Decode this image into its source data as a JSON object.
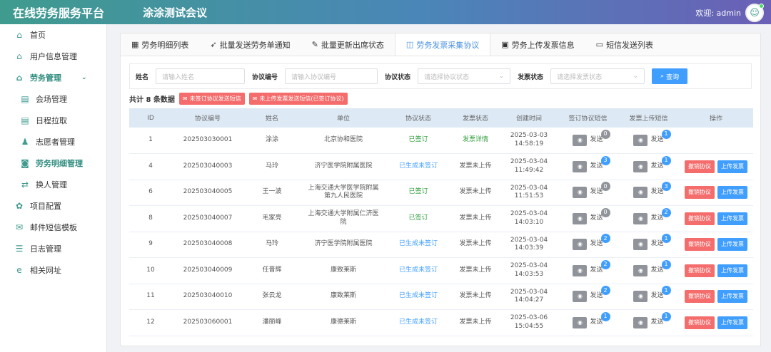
{
  "header": {
    "brand": "在线劳务服务平台",
    "meeting": "涂涂测试会议",
    "welcome": "欢迎: admin"
  },
  "sidebar": [
    {
      "label": "首页",
      "icon": "⌂",
      "cls": ""
    },
    {
      "label": "用户信息管理",
      "icon": "⌂",
      "cls": ""
    },
    {
      "label": "劳务管理",
      "icon": "⌂",
      "cls": "parent",
      "arrow": "⌄"
    },
    {
      "label": "会场管理",
      "icon": "▤",
      "cls": "sub"
    },
    {
      "label": "日程拉取",
      "icon": "▤",
      "cls": "sub"
    },
    {
      "label": "志愿者管理",
      "icon": "♟",
      "cls": "sub"
    },
    {
      "label": "劳务明细管理",
      "icon": "◙",
      "cls": "sub active"
    },
    {
      "label": "换人管理",
      "icon": "⇄",
      "cls": "sub"
    },
    {
      "label": "项目配置",
      "icon": "✿",
      "cls": ""
    },
    {
      "label": "邮件短信模板",
      "icon": "✉",
      "cls": ""
    },
    {
      "label": "日志管理",
      "icon": "☰",
      "cls": ""
    },
    {
      "label": "相关网址",
      "icon": "e",
      "cls": ""
    }
  ],
  "tabs": [
    {
      "label": "劳务明细列表",
      "icon": "▦",
      "active": false
    },
    {
      "label": "批量发送劳务单通知",
      "icon": "➶",
      "active": false
    },
    {
      "label": "批量更新出席状态",
      "icon": "✎",
      "active": false
    },
    {
      "label": "劳务发票采集协议",
      "icon": "◫",
      "active": true
    },
    {
      "label": "劳务上传发票信息",
      "icon": "▣",
      "active": false
    },
    {
      "label": "短信发送列表",
      "icon": "▭",
      "active": false
    }
  ],
  "filters": {
    "name_label": "姓名",
    "name_ph": "请输入姓名",
    "no_label": "协议编号",
    "no_ph": "请输入协议编号",
    "status_label": "协议状态",
    "status_ph": "请选择协议状态",
    "invoice_label": "发票状态",
    "invoice_ph": "请选择发票状态",
    "query": "查询"
  },
  "summary": {
    "count": "共计 8 条数据",
    "btn1": "未签订协议发送短信",
    "btn2": "未上传发票发送短信(已签订协议)"
  },
  "columns": [
    "ID",
    "协议编号",
    "姓名",
    "单位",
    "协议状态",
    "发票状态",
    "创建时间",
    "签订协议短信",
    "发票上传短信",
    "操作"
  ],
  "send_label": "发送",
  "op_labels": {
    "remove": "撤销协议",
    "upload": "上传发票"
  },
  "rows": [
    {
      "id": "1",
      "no": "202503030001",
      "name": "涂涂",
      "unit": "北京协和医院",
      "status": "已签订",
      "status_cls": "ok",
      "invoice": "发票详情",
      "inv_cls": "green",
      "time": "2025-03-03\n14:58:19",
      "s1": "0",
      "s1c": "gray",
      "s2": "1",
      "s2c": "blue",
      "ops": false
    },
    {
      "id": "4",
      "no": "202503040003",
      "name": "马玲",
      "unit": "济宁医学院附属医院",
      "status": "已生成未签订",
      "status_cls": "blue",
      "invoice": "发票未上传",
      "inv_cls": "",
      "time": "2025-03-04\n11:49:42",
      "s1": "3",
      "s1c": "blue",
      "s2": "1",
      "s2c": "blue",
      "ops": true
    },
    {
      "id": "6",
      "no": "202503040005",
      "name": "王一波",
      "unit": "上海交通大学医学院附属\n第九人民医院",
      "status": "已签订",
      "status_cls": "ok",
      "invoice": "发票未上传",
      "inv_cls": "",
      "time": "2025-03-04\n11:51:53",
      "s1": "0",
      "s1c": "gray",
      "s2": "3",
      "s2c": "blue",
      "ops": true
    },
    {
      "id": "8",
      "no": "202503040007",
      "name": "毛家亮",
      "unit": "上海交通大学附属仁济医\n院",
      "status": "已签订",
      "status_cls": "ok",
      "invoice": "发票未上传",
      "inv_cls": "",
      "time": "2025-03-04\n14:03:10",
      "s1": "0",
      "s1c": "gray",
      "s2": "2",
      "s2c": "blue",
      "ops": true
    },
    {
      "id": "9",
      "no": "202503040008",
      "name": "马玲",
      "unit": "济宁医学院附属医院",
      "status": "已生成未签订",
      "status_cls": "blue",
      "invoice": "发票未上传",
      "inv_cls": "",
      "time": "2025-03-04\n14:03:39",
      "s1": "2",
      "s1c": "blue",
      "s2": "1",
      "s2c": "blue",
      "ops": true
    },
    {
      "id": "10",
      "no": "202503040009",
      "name": "任晋辉",
      "unit": "康致莱斯",
      "status": "已生成未签订",
      "status_cls": "blue",
      "invoice": "发票未上传",
      "inv_cls": "",
      "time": "2025-03-04\n14:03:53",
      "s1": "2",
      "s1c": "blue",
      "s2": "1",
      "s2c": "blue",
      "ops": true
    },
    {
      "id": "11",
      "no": "202503040010",
      "name": "张云龙",
      "unit": "康致莱斯",
      "status": "已生成未签订",
      "status_cls": "blue",
      "invoice": "发票未上传",
      "inv_cls": "",
      "time": "2025-03-04\n14:04:27",
      "s1": "2",
      "s1c": "blue",
      "s2": "1",
      "s2c": "blue",
      "ops": true
    },
    {
      "id": "12",
      "no": "202503060001",
      "name": "潘丽峰",
      "unit": "康德莱斯",
      "status": "已生成未签订",
      "status_cls": "blue",
      "invoice": "发票未上传",
      "inv_cls": "",
      "time": "2025-03-06\n15:04:55",
      "s1": "1",
      "s1c": "blue",
      "s2": "1",
      "s2c": "blue",
      "ops": true
    }
  ]
}
